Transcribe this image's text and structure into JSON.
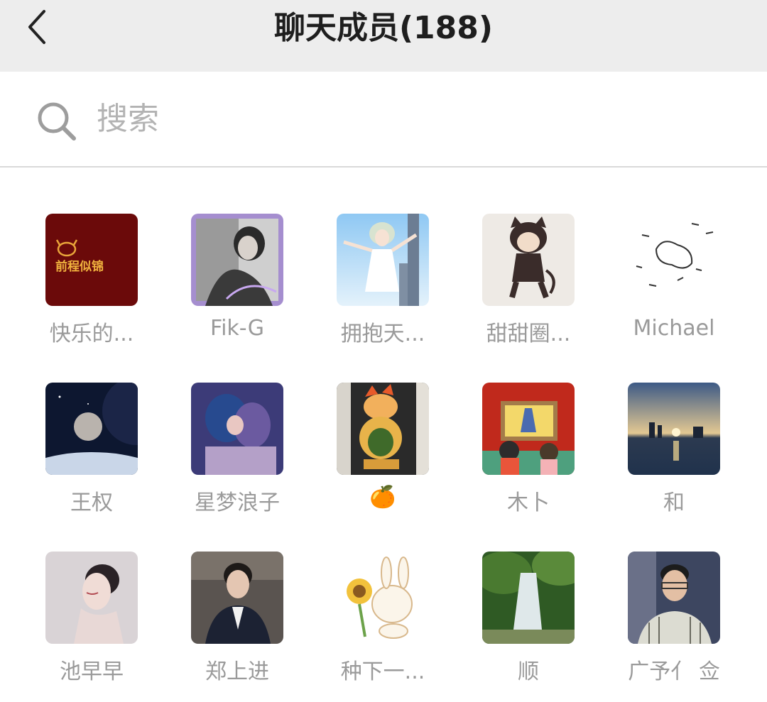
{
  "header": {
    "title": "聊天成员(188)"
  },
  "search": {
    "placeholder": "搜索"
  },
  "members": [
    {
      "name": "快乐的..."
    },
    {
      "name": "Fik-G"
    },
    {
      "name": "拥抱天..."
    },
    {
      "name": "甜甜圈..."
    },
    {
      "name": "Michael"
    },
    {
      "name": "王权"
    },
    {
      "name": "星梦浪子"
    },
    {
      "name": "🍊"
    },
    {
      "name": "木卜"
    },
    {
      "name": "和"
    },
    {
      "name": "池早早"
    },
    {
      "name": "郑上进"
    },
    {
      "name": "种下一..."
    },
    {
      "name": "顺"
    },
    {
      "name": "广予亻 佥"
    }
  ],
  "avatar_logo_text": "前程似锦"
}
